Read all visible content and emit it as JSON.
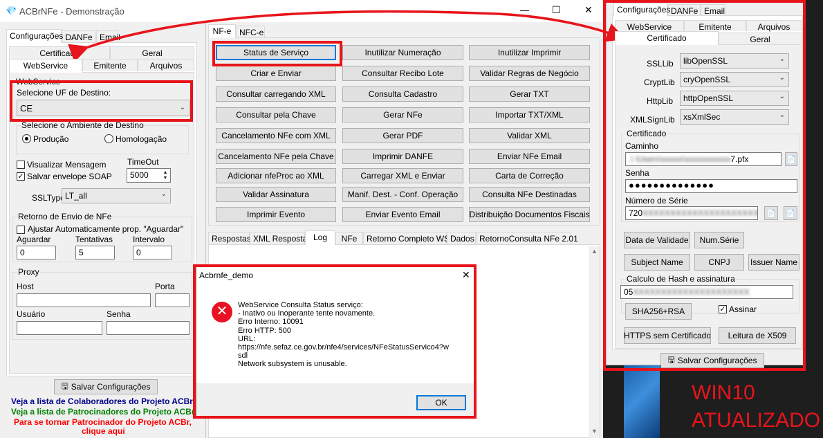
{
  "main_window": {
    "title": "ACBrNFe - Demonstração",
    "controls": {
      "minimize": "—",
      "maximize": "☐",
      "close": "✕"
    }
  },
  "left": {
    "top_tabs": [
      "Configurações",
      "DANFe",
      "Email"
    ],
    "sub_tabs_row1": [
      "Certificado",
      "Geral"
    ],
    "sub_tabs_row2": [
      "WebService",
      "Emitente",
      "Arquivos"
    ],
    "webservice_group": "WebService",
    "uf_label": "Selecione UF de Destino:",
    "uf_value": "CE",
    "ambiente_group": "Selecione o Ambiente de Destino",
    "ambiente_options": [
      "Produção",
      "Homologação"
    ],
    "visualizar_msg": "Visualizar Mensagem",
    "salvar_soap": "Salvar envelope SOAP",
    "timeout_label": "TimeOut",
    "timeout_value": "5000",
    "ssltype_label": "SSLType",
    "ssltype_value": "LT_all",
    "retorno_group": "Retorno de Envio de NFe",
    "ajustar_label": "Ajustar Automaticamente prop. \"Aguardar\"",
    "aguardar_label": "Aguardar",
    "aguardar_value": "0",
    "tentativas_label": "Tentativas",
    "tentativas_value": "5",
    "intervalo_label": "Intervalo",
    "intervalo_value": "0",
    "proxy_group": "Proxy",
    "host_label": "Host",
    "porta_label": "Porta",
    "usuario_label": "Usuário",
    "senha_label": "Senha",
    "salvar_btn": "Salvar Configurações",
    "link_colab": "Veja a lista de Colaboradores do Projeto ACBr",
    "link_patro": "Veja a lista de Patrocinadores do Projeto ACBr",
    "link_tornar": "Para se tornar Patrocinador do Projeto ACBr,",
    "link_clique": "clique aqui"
  },
  "center": {
    "tabs": [
      "NF-e",
      "NFC-e"
    ],
    "buttons": [
      [
        "Status de Serviço",
        "Inutilizar Numeração",
        "Inutilizar Imprimir"
      ],
      [
        "Criar e Enviar",
        "Consultar Recibo Lote",
        "Validar Regras de Negócio"
      ],
      [
        "Consultar carregando XML",
        "Consulta Cadastro",
        "Gerar TXT"
      ],
      [
        "Consultar pela Chave",
        "Gerar NFe",
        "Importar TXT/XML"
      ],
      [
        "Cancelamento NFe com XML",
        "Gerar PDF",
        "Validar XML"
      ],
      [
        "Cancelamento NFe pela Chave",
        "Imprimir DANFE",
        "Enviar NFe Email"
      ],
      [
        "Adicionar nfeProc ao XML",
        "Carregar XML e Enviar",
        "Carta de Correção"
      ],
      [
        "Validar Assinatura",
        "Manif. Dest. - Conf. Operação",
        "Consulta NFe Destinadas"
      ],
      [
        "Imprimir Evento",
        "Enviar Evento Email",
        "Distribuição Documentos Fiscais"
      ]
    ],
    "bottom_tabs": [
      "Respostas",
      "XML Resposta",
      "Log",
      "NFe",
      "Retorno Completo WS",
      "Dados",
      "RetornoConsulta NFe 2.01"
    ]
  },
  "dialog": {
    "title": "Acbrnfe_demo",
    "close": "✕",
    "message_lines": [
      "WebService Consulta Status serviço:",
      "- Inativo ou Inoperante tente novamente.",
      "Erro Interno: 10091",
      "Erro HTTP: 500",
      "URL:",
      "https://nfe.sefaz.ce.gov.br/nfe4/services/NFeStatusServico4?w",
      "sdl",
      "Network subsystem is unusable."
    ],
    "ok": "OK"
  },
  "right": {
    "top_tabs": [
      "Configurações",
      "DANFe",
      "Email"
    ],
    "sub_tabs_row1": [
      "WebService",
      "Emitente",
      "Arquivos"
    ],
    "sub_tabs_row2": [
      "Certificado",
      "Geral"
    ],
    "ssllib_label": "SSLLib",
    "ssllib_value": "libOpenSSL",
    "cryptlib_label": "CryptLib",
    "cryptlib_value": "cryOpenSSL",
    "httplib_label": "HttpLib",
    "httplib_value": "httpOpenSSL",
    "xmlsign_label": "XMLSignLib",
    "xmlsign_value": "xsXmlSec",
    "cert_group": "Certificado",
    "caminho_label": "Caminho",
    "caminho_value": "7.pfx",
    "senha_label": "Senha",
    "senha_value": "●●●●●●●●●●●●●●",
    "serie_label": "Número de Série",
    "serie_value": "720",
    "data_validade": "Data de Validade",
    "num_serie": "Num.Série",
    "subject_name": "Subject Name",
    "cnpj": "CNPJ",
    "issuer_name": "Issuer Name",
    "hash_group": "Calculo de Hash e assinatura",
    "hash_value": "05",
    "sha_btn": "SHA256+RSA",
    "assinar": "Assinar",
    "https_btn": "HTTPS sem Certificado",
    "leitura_btn": "Leitura de X509",
    "salvar_btn": "Salvar Configurações"
  },
  "annotation": {
    "line1": "WIN10",
    "line2": "ATUALIZADO"
  },
  "colors": {
    "annotation_red": "#e8141b",
    "link_blue": "#00008b",
    "link_green": "#008000",
    "link_red": "#ff0000",
    "error_red": "#e81123"
  }
}
